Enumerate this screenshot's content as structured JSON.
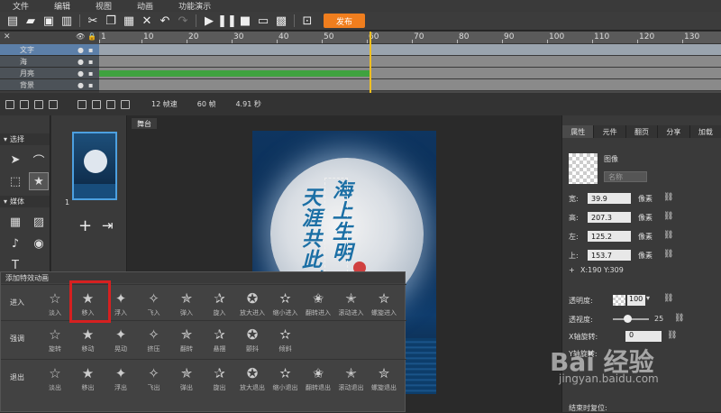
{
  "menu": [
    "文件",
    "编辑",
    "视图",
    "动画",
    "功能演示"
  ],
  "toolbar": {
    "publish_label": "发布"
  },
  "timeline": {
    "ticks": [
      "1",
      "10",
      "20",
      "30",
      "40",
      "50",
      "60",
      "70",
      "80",
      "90",
      "100",
      "110",
      "120",
      "130"
    ],
    "layers": [
      {
        "name": "文字",
        "selected": true
      },
      {
        "name": "海",
        "selected": false
      },
      {
        "name": "月亮",
        "selected": false
      },
      {
        "name": "背景",
        "selected": false
      }
    ],
    "fps_label": "12 帧速",
    "frames_label": "60 帧",
    "seconds_label": "4.91 秒"
  },
  "tools": {
    "select_section": "选择",
    "media_section": "媒体"
  },
  "pages": {
    "page_number": "1"
  },
  "stage": {
    "tab_label": "舞台",
    "text_left": "天涯共此时",
    "text_right": "海上生明"
  },
  "props": {
    "tabs": [
      "属性",
      "元件",
      "翻页",
      "分享",
      "加载"
    ],
    "type_label": "图像",
    "name_placeholder": "名称",
    "width_label": "宽:",
    "width_value": "39.9",
    "height_label": "高:",
    "height_value": "207.3",
    "left_label": "左:",
    "left_value": "125.2",
    "top_label": "上:",
    "top_value": "153.7",
    "unit": "像素",
    "xy": "X:190   Y:309",
    "opacity_label": "透明度:",
    "opacity_value": "100",
    "brightness_label": "透视度:",
    "brightness_value": "25",
    "xrot_label": "X轴旋转:",
    "xrot_value": "0",
    "yrot_label": "Y轴旋转:",
    "bottom_label": "结束时复位:"
  },
  "anim": {
    "title": "添加特效动画",
    "rows": [
      {
        "label": "进入",
        "items": [
          "淡入",
          "移入",
          "浮入",
          "飞入",
          "弹入",
          "旋入",
          "放大进入",
          "缩小进入",
          "翻转进入",
          "滚动进入",
          "螺旋进入"
        ]
      },
      {
        "label": "强调",
        "items": [
          "旋转",
          "移动",
          "晃动",
          "挤压",
          "翻转",
          "悬摆",
          "颤抖",
          "倾斜"
        ]
      },
      {
        "label": "退出",
        "items": [
          "淡出",
          "移出",
          "浮出",
          "飞出",
          "弹出",
          "旋出",
          "放大退出",
          "缩小退出",
          "翻转退出",
          "滚动退出",
          "螺旋退出"
        ]
      }
    ]
  },
  "watermark": {
    "brand": "Bai 经验",
    "url": "jingyan.baidu.com"
  }
}
